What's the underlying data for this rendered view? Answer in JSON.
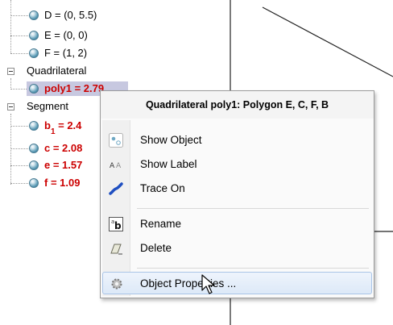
{
  "tree": {
    "points": [
      {
        "label": "D = (0, 5.5)"
      },
      {
        "label": "E = (0, 0)"
      },
      {
        "label": "F = (1, 2)"
      }
    ],
    "quadrilateral_group": "Quadrilateral",
    "poly": {
      "name": "poly1",
      "value": " = 2.79"
    },
    "segment_group": "Segment",
    "segments": [
      {
        "name": "b",
        "sub": "1",
        "value": " = 2.4"
      },
      {
        "name": "c",
        "sub": "",
        "value": " = 2.08"
      },
      {
        "name": "e",
        "sub": "",
        "value": " = 1.57"
      },
      {
        "name": "f",
        "sub": "",
        "value": " = 1.09"
      }
    ]
  },
  "menu": {
    "title": "Quadrilateral poly1: Polygon E, C, F, B",
    "items": [
      {
        "label": "Show Object",
        "icon": "show-object-icon"
      },
      {
        "label": "Show Label",
        "icon": "show-label-icon"
      },
      {
        "label": "Trace On",
        "icon": "trace-icon"
      },
      {
        "label": "Rename",
        "icon": "rename-icon"
      },
      {
        "label": "Delete",
        "icon": "eraser-icon"
      },
      {
        "label": "Object Properties ...",
        "icon": "gear-icon"
      }
    ]
  },
  "colors": {
    "dependent_text": "#cc0000",
    "selection": "#c7c8e0",
    "menu_hover": "#dde9f8"
  }
}
